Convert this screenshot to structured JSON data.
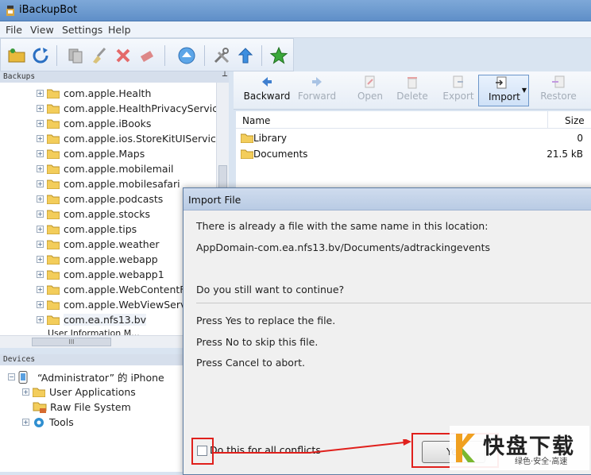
{
  "window": {
    "title": "iBackupBot"
  },
  "menu": [
    "File",
    "View",
    "Settings",
    "Help"
  ],
  "backups_pane": {
    "header": "Backups",
    "pin": "Ł",
    "items": [
      "com.apple.Health",
      "com.apple.HealthPrivacyService",
      "com.apple.iBooks",
      "com.apple.ios.StoreKitUIService",
      "com.apple.Maps",
      "com.apple.mobilemail",
      "com.apple.mobilesafari",
      "com.apple.podcasts",
      "com.apple.stocks",
      "com.apple.tips",
      "com.apple.weather",
      "com.apple.webapp",
      "com.apple.webapp1",
      "com.apple.WebContentFilt",
      "com.apple.WebViewServic",
      "com.ea.nfs13.bv"
    ],
    "partial_item": "User Information M...",
    "hscroll_grip": "III"
  },
  "devices_pane": {
    "header": "Devices",
    "device": "“Administrator” 的 iPhone",
    "items": [
      "User Applications",
      "Raw File System",
      "Tools"
    ]
  },
  "right_toolbar": {
    "buttons": [
      {
        "label": "Backward",
        "enabled": true
      },
      {
        "label": "Forward",
        "enabled": false
      },
      {
        "label": "Open",
        "enabled": false
      },
      {
        "label": "Delete",
        "enabled": false
      },
      {
        "label": "Export",
        "enabled": false
      },
      {
        "label": "Import",
        "enabled": true
      },
      {
        "label": "Restore",
        "enabled": false
      }
    ]
  },
  "file_list": {
    "columns": {
      "name": "Name",
      "size": "Size"
    },
    "rows": [
      {
        "name": "Library",
        "size": "0"
      },
      {
        "name": "Documents",
        "size": "21.5 kB"
      }
    ]
  },
  "dialog": {
    "title": "Import File",
    "line1": "There is already a file with the same name in this location:",
    "path": "AppDomain-com.ea.nfs13.bv/Documents/adtrackingevents",
    "question": "Do you still want to continue?",
    "yes_hint": "Press Yes to replace the file.",
    "no_hint": "Press No to skip this file.",
    "cancel_hint": "Press Cancel to abort.",
    "checkbox_label": "Do this for all conflicts",
    "yes_button": "Ye"
  },
  "watermark": {
    "brand": "快盘下载",
    "tagline": "绿色·安全·高速"
  },
  "colors": {
    "highlight": "#e0201c",
    "title_bar": "#6b98cf"
  }
}
